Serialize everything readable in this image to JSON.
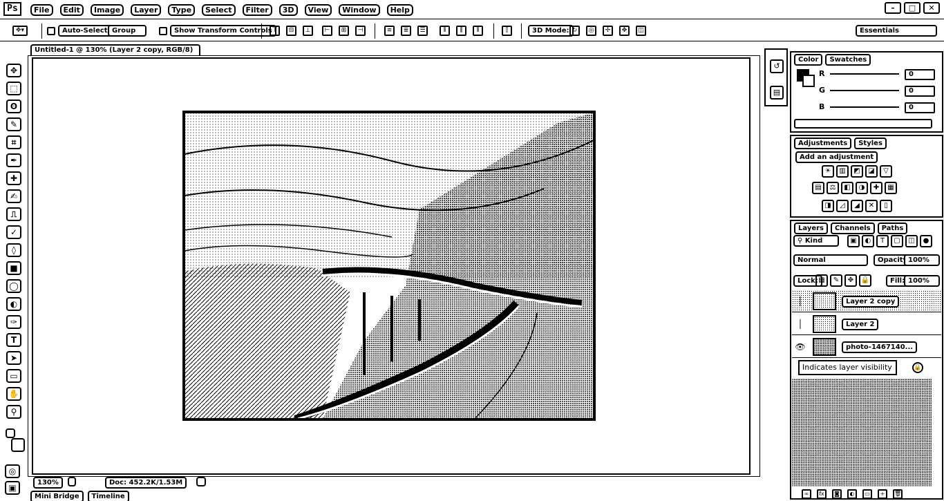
{
  "app": {
    "logo": "Ps"
  },
  "menubar": {
    "items": [
      "File",
      "Edit",
      "Image",
      "Layer",
      "Type",
      "Select",
      "Filter",
      "3D",
      "View",
      "Window",
      "Help"
    ],
    "window_buttons": [
      "–",
      "□",
      "✕"
    ]
  },
  "options": {
    "auto_select_label": "Auto-Select:",
    "auto_select_value": "Group",
    "show_transform_label": "Show Transform Controls",
    "mode_label": "3D Mode:",
    "workspace": "Essentials"
  },
  "tools": [
    {
      "name": "move-tool",
      "glyph": "✥"
    },
    {
      "name": "marquee-tool",
      "glyph": "⬚"
    },
    {
      "name": "lasso-tool",
      "glyph": "ʘ"
    },
    {
      "name": "quick-select-tool",
      "glyph": "✎"
    },
    {
      "name": "crop-tool",
      "glyph": "⌗"
    },
    {
      "name": "eyedropper-tool",
      "glyph": "✒"
    },
    {
      "name": "healing-tool",
      "glyph": "✚"
    },
    {
      "name": "brush-tool",
      "glyph": "✍"
    },
    {
      "name": "stamp-tool",
      "glyph": "⎍"
    },
    {
      "name": "history-brush-tool",
      "glyph": "✓"
    },
    {
      "name": "eraser-tool",
      "glyph": "◊"
    },
    {
      "name": "gradient-tool",
      "glyph": "■"
    },
    {
      "name": "blur-tool",
      "glyph": "◯"
    },
    {
      "name": "dodge-tool",
      "glyph": "◐"
    },
    {
      "name": "pen-tool",
      "glyph": "✑"
    },
    {
      "name": "type-tool",
      "glyph": "T"
    },
    {
      "name": "path-select-tool",
      "glyph": "➤"
    },
    {
      "name": "shape-tool",
      "glyph": "▭"
    },
    {
      "name": "hand-tool",
      "glyph": "✋"
    },
    {
      "name": "zoom-tool",
      "glyph": "⚲"
    }
  ],
  "document": {
    "tab_title": "Untitled-1 @ 130% (Layer 2 copy, RGB/8)",
    "zoom": "130%",
    "doc_info": "Doc: 452.2K/1.53M"
  },
  "bottom_tabs": [
    "Mini Bridge",
    "Timeline"
  ],
  "color_panel": {
    "tabs": [
      "Color",
      "Swatches"
    ],
    "channels": [
      {
        "label": "R",
        "value": "0"
      },
      {
        "label": "G",
        "value": "0"
      },
      {
        "label": "B",
        "value": "0"
      }
    ]
  },
  "adjustments_panel": {
    "tabs": [
      "Adjustments",
      "Styles"
    ],
    "heading": "Add an adjustment",
    "rows": [
      [
        "☀",
        "▥",
        "◩",
        "◪",
        "▽"
      ],
      [
        "▤",
        "⚖",
        "◧",
        "◑",
        "✚",
        "▦"
      ],
      [
        "◨",
        "◿",
        "◢",
        "✕",
        "▯"
      ]
    ]
  },
  "layers_panel": {
    "tabs": [
      "Layers",
      "Channels",
      "Paths"
    ],
    "kind_filter": "Kind",
    "blend_mode": "Normal",
    "opacity_label": "Opacity:",
    "opacity_value": "100%",
    "lock_label": "Lock:",
    "fill_label": "Fill:",
    "fill_value": "100%",
    "layers": [
      {
        "name": "Layer 2 copy",
        "visible": false,
        "selected": true
      },
      {
        "name": "Layer 2",
        "visible": false,
        "selected": false
      },
      {
        "name": "photo-1467140...",
        "visible": true,
        "selected": false
      }
    ],
    "tooltip": "Indicates layer visibility"
  }
}
